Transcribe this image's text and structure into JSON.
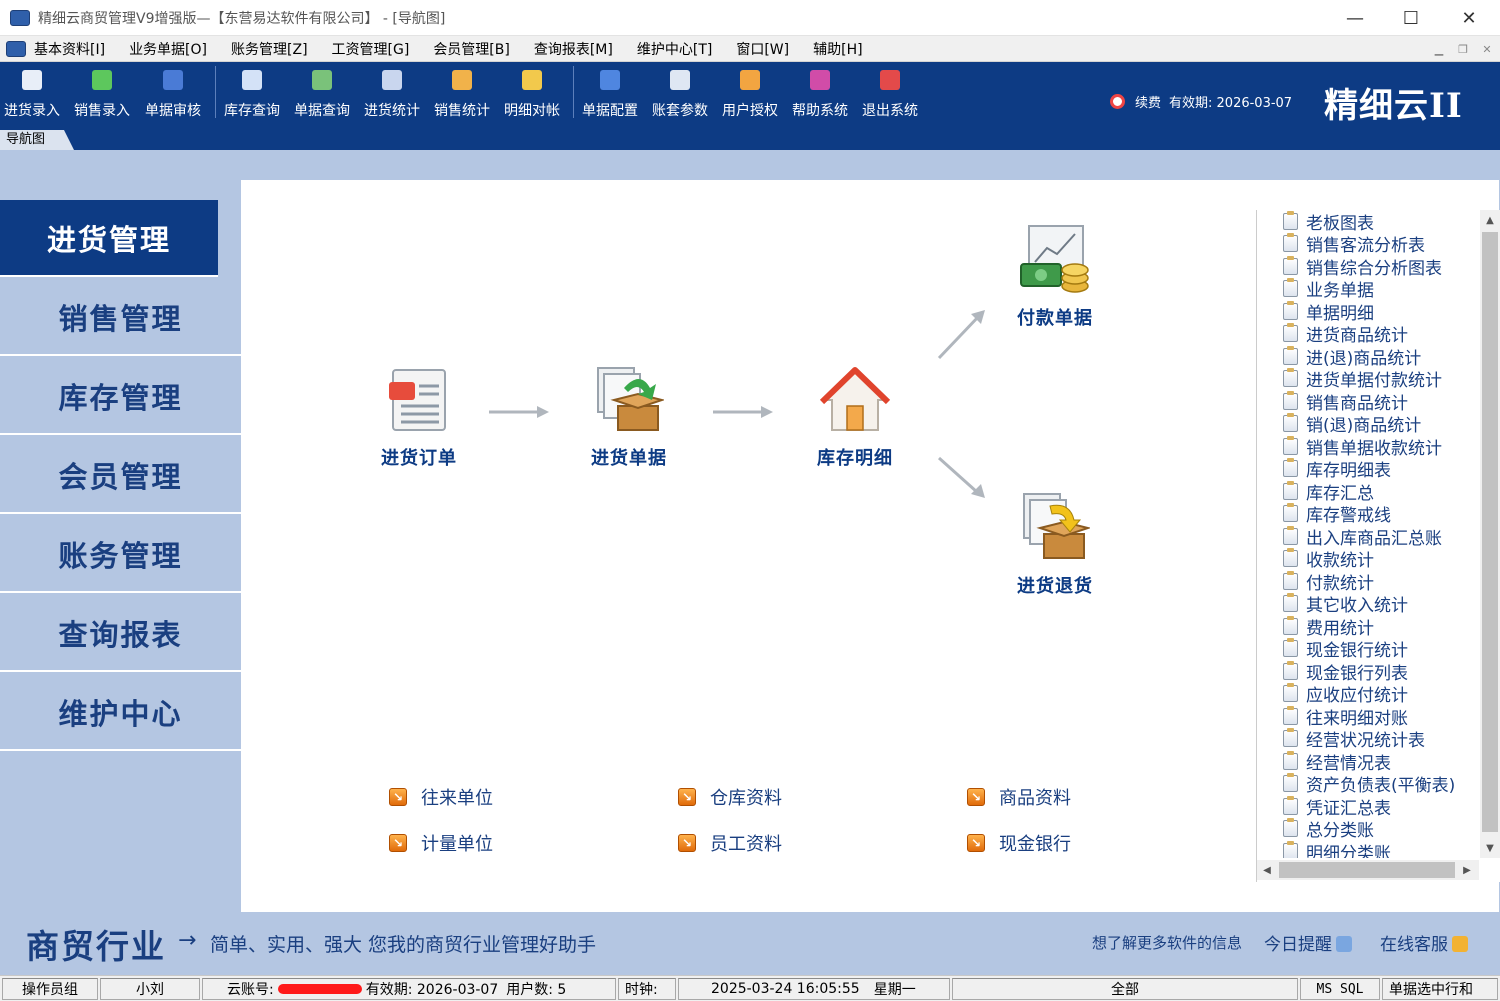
{
  "window": {
    "title": "精细云商贸管理V9增强版—【东营易达软件有限公司】 - [导航图]"
  },
  "menu": [
    "基本资料[I]",
    "业务单据[O]",
    "账务管理[Z]",
    "工资管理[G]",
    "会员管理[B]",
    "查询报表[M]",
    "维护中心[T]",
    "窗口[W]",
    "辅助[H]"
  ],
  "toolbar": [
    {
      "label": "进货录入",
      "icon": "save-icon",
      "color": "#e8eef8"
    },
    {
      "label": "销售录入",
      "icon": "heart-icon",
      "color": "#5dc75d"
    },
    {
      "label": "单据审核",
      "icon": "check-icon",
      "color": "#4a7bd6"
    },
    {
      "label": "库存查询",
      "icon": "magnifier-icon",
      "color": "#d4e2f7"
    },
    {
      "label": "单据查询",
      "icon": "printer-icon",
      "color": "#7ac27a"
    },
    {
      "label": "进货统计",
      "icon": "report-icon",
      "color": "#c9d6ee"
    },
    {
      "label": "销售统计",
      "icon": "chart-icon",
      "color": "#f1b24a"
    },
    {
      "label": "明细对帐",
      "icon": "coins-icon",
      "color": "#f2c94c"
    },
    {
      "label": "单据配置",
      "icon": "document-icon",
      "color": "#4f86e0"
    },
    {
      "label": "账套参数",
      "icon": "settings-icon",
      "color": "#dfe7f3"
    },
    {
      "label": "用户授权",
      "icon": "users-icon",
      "color": "#f2a541"
    },
    {
      "label": "帮助系统",
      "icon": "help-book-icon",
      "color": "#d14ca8"
    },
    {
      "label": "退出系统",
      "icon": "exit-door-icon",
      "color": "#e34a4a"
    }
  ],
  "license": {
    "renew": "续费",
    "validity": "有效期: 2026-03-07"
  },
  "brand": "精细云II",
  "nav_tab": "导航图",
  "left_nav": [
    "进货管理",
    "销售管理",
    "库存管理",
    "会员管理",
    "账务管理",
    "查询报表",
    "维护中心"
  ],
  "flow": {
    "purchase_order": "进货订单",
    "purchase_doc": "进货单据",
    "stock_detail": "库存明细",
    "payment_doc": "付款单据",
    "purchase_return": "进货退货"
  },
  "shortcuts": [
    "往来单位",
    "仓库资料",
    "商品资料",
    "计量单位",
    "员工资料",
    "现金银行"
  ],
  "reports": [
    "老板图表",
    "销售客流分析表",
    "销售综合分析图表",
    "业务单据",
    "单据明细",
    "进货商品统计",
    "进(退)商品统计",
    "进货单据付款统计",
    "销售商品统计",
    "销(退)商品统计",
    "销售单据收款统计",
    "库存明细表",
    "库存汇总",
    "库存警戒线",
    "出入库商品汇总账",
    "收款统计",
    "付款统计",
    "其它收入统计",
    "费用统计",
    "现金银行统计",
    "现金银行列表",
    "应收应付统计",
    "往来明细对账",
    "经营状况统计表",
    "经营情况表",
    "资产负债表(平衡表)",
    "凭证汇总表",
    "总分类账",
    "明细分类账"
  ],
  "slogan": {
    "big": "商贸行业",
    "arrow": "→",
    "small": "简单、实用、强大 您我的商贸行业管理好助手"
  },
  "links": {
    "more_info": "想了解更多软件的信息",
    "today_reminder": "今日提醒",
    "online_service": "在线客服"
  },
  "status": {
    "operator_group": "操作员组",
    "user": "小刘",
    "cloud_account_label": "云账号:",
    "validity": "有效期: 2026-03-07",
    "user_count": "用户数: 5",
    "clock_label": "时钟:",
    "clock": "2025-03-24 16:05:55",
    "weekday": "星期一",
    "scope": "全部",
    "db": "MS SQL",
    "hint": "单据选中行和"
  }
}
